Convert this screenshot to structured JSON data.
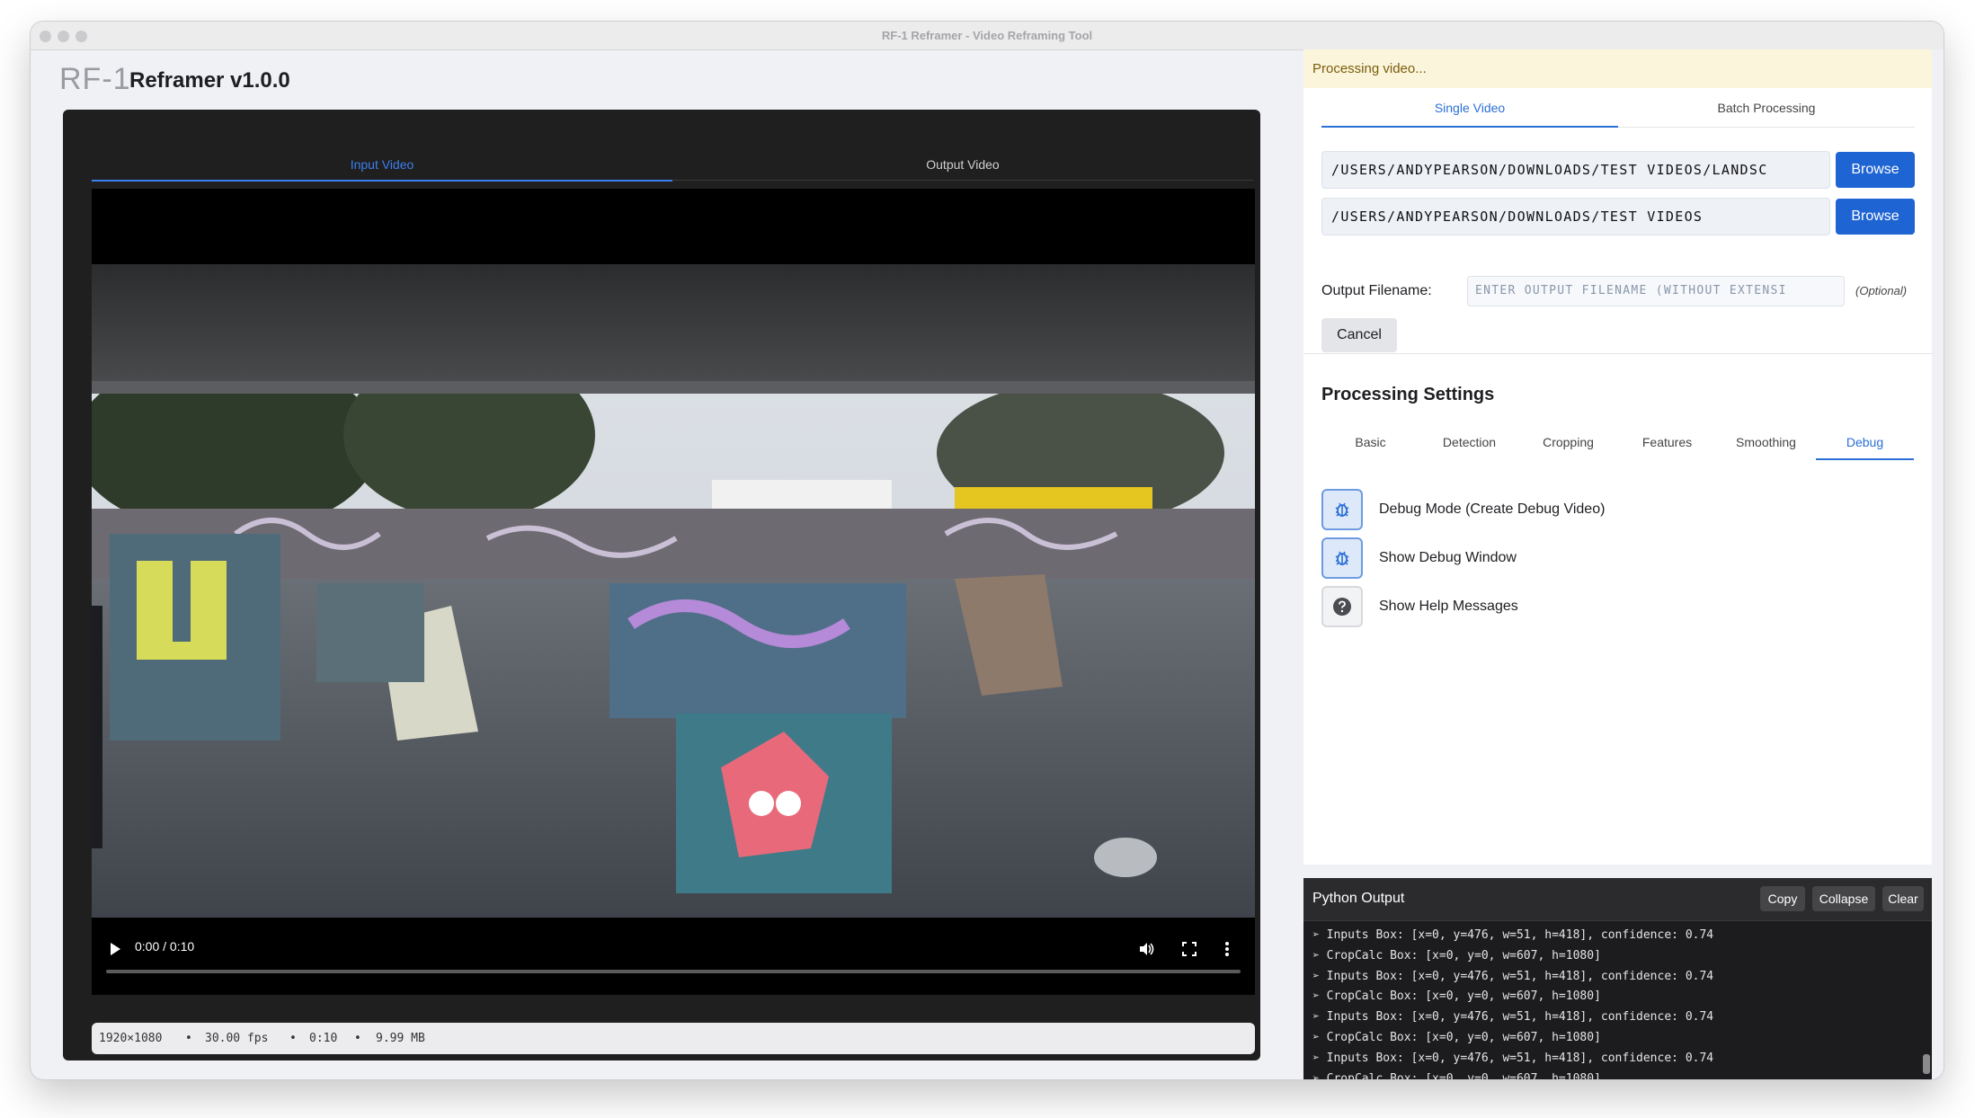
{
  "window": {
    "title": "RF-1 Reframer - Video Reframing Tool"
  },
  "app": {
    "logo": "RF-1",
    "name": "Reframer v1.0.0"
  },
  "video_tabs": [
    {
      "label": "Input Video",
      "active": true
    },
    {
      "label": "Output Video",
      "active": false
    }
  ],
  "player": {
    "time": "0:00 / 0:10",
    "progress": 0
  },
  "video_meta": {
    "resolution": "1920×1080",
    "fps": "30.00 fps",
    "duration": "0:10",
    "size": "9.99 MB",
    "sep": "•"
  },
  "status": {
    "banner": "Processing video..."
  },
  "process_tabs": [
    {
      "label": "Single Video",
      "active": true
    },
    {
      "label": "Batch Processing",
      "active": false
    }
  ],
  "inputs": {
    "input_path": "/Users/andypearson/Downloads/Test Videos/Landsc",
    "output_dir": "/Users/andypearson/Downloads/Test Videos",
    "browse_label": "Browse",
    "output_filename_label": "Output Filename:",
    "output_filename_placeholder": "Enter output filename (without extensi",
    "optional": "(Optional)",
    "cancel_label": "Cancel"
  },
  "settings": {
    "title": "Processing Settings",
    "tabs": [
      "Basic",
      "Detection",
      "Cropping",
      "Features",
      "Smoothing",
      "Debug"
    ],
    "active_tab": "Debug",
    "toggles": [
      {
        "label": "Debug Mode (Create Debug Video)",
        "icon": "bug-icon",
        "on": true
      },
      {
        "label": "Show Debug Window",
        "icon": "bug-icon",
        "on": true
      },
      {
        "label": "Show Help Messages",
        "icon": "help-icon",
        "on": false
      }
    ]
  },
  "console": {
    "title": "Python Output",
    "buttons": {
      "copy": "Copy",
      "collapse": "Collapse",
      "clear": "Clear"
    },
    "lines": [
      "➢ Inputs Box: [x=0, y=476, w=51, h=418], confidence: 0.74",
      "➢ CropCalc Box: [x=0, y=0, w=607, h=1080]",
      "➢ Inputs Box: [x=0, y=476, w=51, h=418], confidence: 0.74",
      "➢ CropCalc Box: [x=0, y=0, w=607, h=1080]",
      "➢ Inputs Box: [x=0, y=476, w=51, h=418], confidence: 0.74",
      "➢ CropCalc Box: [x=0, y=0, w=607, h=1080]",
      "➢ Inputs Box: [x=0, y=476, w=51, h=418], confidence: 0.74",
      "➢ CropCalc Box: [x=0, y=0, w=607, h=1080]"
    ]
  },
  "colors": {
    "accent": "#1f64d3",
    "tab_active": "#3d7ef0",
    "banner_bg": "#fbf5dc",
    "console_bg": "#1c1c1e"
  }
}
